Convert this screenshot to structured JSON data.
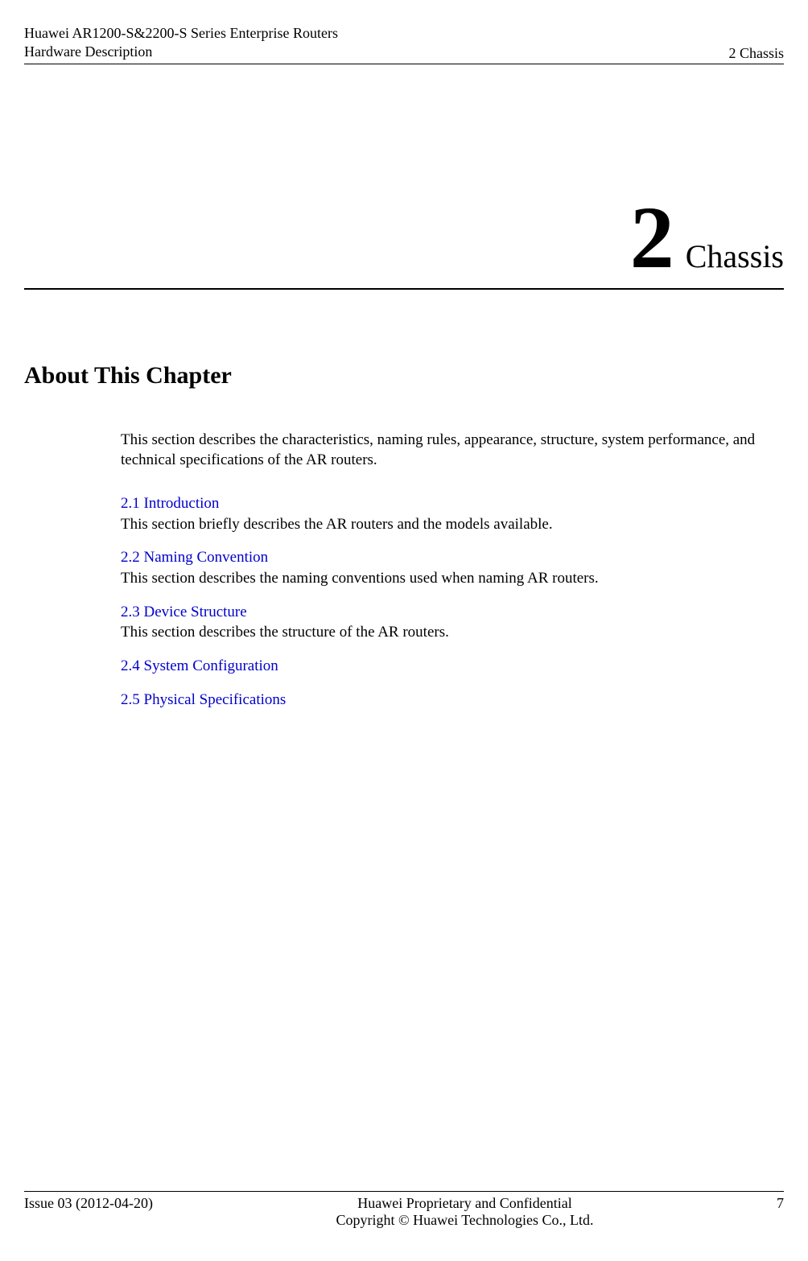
{
  "header": {
    "left_line1": "Huawei AR1200-S&2200-S Series Enterprise Routers",
    "left_line2": "Hardware Description",
    "right": "2 Chassis"
  },
  "chapter": {
    "number": "2",
    "title": "Chassis"
  },
  "section_heading": "About This Chapter",
  "intro": "This section describes the characteristics, naming rules, appearance, structure, system performance, and technical specifications of the AR routers.",
  "toc": [
    {
      "link": "2.1 Introduction",
      "desc": "This section briefly describes the AR routers and the models available."
    },
    {
      "link": "2.2 Naming Convention",
      "desc": "This section describes the naming conventions used when naming AR routers."
    },
    {
      "link": "2.3 Device Structure",
      "desc": "This section describes the structure of the AR routers."
    },
    {
      "link": "2.4 System Configuration",
      "desc": ""
    },
    {
      "link": "2.5 Physical Specifications",
      "desc": ""
    }
  ],
  "footer": {
    "left": "Issue 03 (2012-04-20)",
    "center_line1": "Huawei Proprietary and Confidential",
    "center_line2": "Copyright © Huawei Technologies Co., Ltd.",
    "right": "7"
  }
}
